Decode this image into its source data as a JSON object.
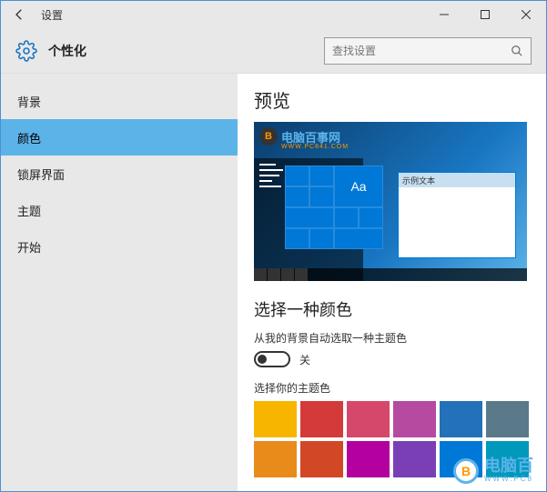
{
  "window": {
    "title": "设置"
  },
  "header": {
    "page_title": "个性化",
    "search_placeholder": "查找设置"
  },
  "sidebar": {
    "items": [
      {
        "label": "背景",
        "active": false
      },
      {
        "label": "颜色",
        "active": true
      },
      {
        "label": "锁屏界面",
        "active": false
      },
      {
        "label": "主题",
        "active": false
      },
      {
        "label": "开始",
        "active": false
      }
    ]
  },
  "content": {
    "preview_heading": "预览",
    "preview": {
      "logo_text": "电脑百事网",
      "logo_sub": "WWW.PC841.COM",
      "logo_badge": "B",
      "sample_window_title": "示例文本",
      "tile_text": "Aa"
    },
    "color_heading": "选择一种颜色",
    "auto_pick_label": "从我的背景自动选取一种主题色",
    "toggle_state": "关",
    "accent_label": "选择你的主题色",
    "swatches_row1": [
      "#f7b500",
      "#d43a3a",
      "#d6486b",
      "#b54aa0",
      "#2371b8",
      "#5a7a8a"
    ],
    "swatches_row2": [
      "#e88b1a",
      "#d24726",
      "#b4009e",
      "#7a3fb5",
      "#0078d7",
      "#0099bc"
    ]
  },
  "watermark": {
    "badge": "B",
    "text": "电脑百",
    "sub": "WWW.PC8"
  }
}
